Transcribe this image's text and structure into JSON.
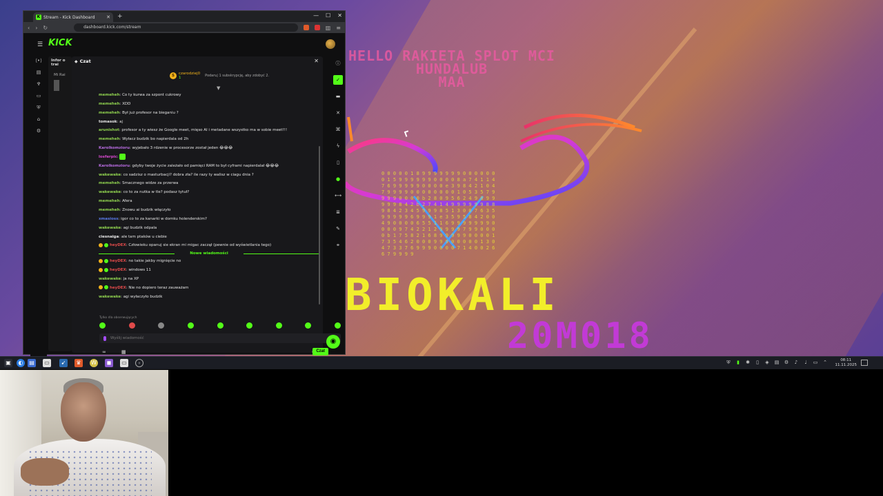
{
  "browser": {
    "tab_title": "Stream - Kick Dashboard",
    "url": "dashboard.kick.com/stream",
    "brand": "KICK",
    "accent": "#53fc18"
  },
  "info_panel": {
    "title": "Infor o trai",
    "meta": "Mi Rai"
  },
  "chat": {
    "title": "Czat",
    "subscriber": {
      "name": "czarodziej0",
      "count": "1",
      "message": "Podaruj 1 subskrypcję, aby zdobyć 2."
    },
    "messages": [
      {
        "user": "memeheh",
        "color": "#8fd14f",
        "text": "Co ty kurwa za szpont cukrowy"
      },
      {
        "user": "memeheh",
        "color": "#8fd14f",
        "text": "XDD"
      },
      {
        "user": "memeheh",
        "color": "#8fd14f",
        "text": "Był już profesor na bieganiu ?"
      },
      {
        "user": "tomasok",
        "color": "#e6e6e6",
        "text": "aj"
      },
      {
        "user": "arunishot",
        "color": "#8fd14f",
        "text": "profesor a ty wiesz że Google meet, mięso AI i metadane wszystko ma w sobie meet!!!"
      },
      {
        "user": "memeheh",
        "color": "#8fd14f",
        "text": "Wyłacz budzik bo napierdala od 2h"
      },
      {
        "user": "Karolkomzioru",
        "color": "#b86ce0",
        "text": "wyjebało 3 rdzenie w procesorze został jeden 😂😂😂"
      },
      {
        "user": "losferpic",
        "color": "#d94ad0",
        "text": ""
      },
      {
        "user": "Karolkomzioru",
        "color": "#b86ce0",
        "text": "gdyby twoje życie zależało od pamięci RAM to był cyframi napierdalał 😂😂😂"
      },
      {
        "user": "wakewake",
        "color": "#8fd14f",
        "text": "co sadzisz o masturbacji? dobra zła? ile razy ty walisz w ciagu dnia ?"
      },
      {
        "user": "memeheh",
        "color": "#8fd14f",
        "text": "Smacznego widze za przerwa"
      },
      {
        "user": "wakewake",
        "color": "#8fd14f",
        "text": "co to za nutka w tle? podasz tytuł?"
      },
      {
        "user": "memeheh",
        "color": "#8fd14f",
        "text": "Afera"
      },
      {
        "user": "memeheh",
        "color": "#8fd14f",
        "text": "Znowu ai budzik włączyło"
      },
      {
        "user": "xmasioss",
        "color": "#5a7be8",
        "text": "igor co to za kanarki w domku holenderskim?"
      },
      {
        "user": "wakewake",
        "color": "#8fd14f",
        "text": "agi budzik odpala"
      },
      {
        "user": "ciesnaiga",
        "color": "#e6e6e6",
        "text": "ale tam ptaków u ciebie"
      },
      {
        "user": "heyDEX",
        "color": "#e04a4a",
        "text": "Człowieku opanuj sie ekran mi migac zaczął (pewnie od wyświetlania tego)"
      }
    ],
    "new_messages_label": "Nowe wiadomości",
    "new_messages": [
      {
        "user": "heyDEX",
        "color": "#e04a4a",
        "text": "no takie jakby mignięcie no"
      },
      {
        "user": "heyDEX",
        "color": "#e04a4a",
        "text": "windows 11"
      },
      {
        "user": "wakewake",
        "color": "#8fd14f",
        "text": "ja na XP"
      },
      {
        "user": "heyDEX",
        "color": "#e04a4a",
        "text": "Nie no dopiero teraz zauważam"
      },
      {
        "user": "wakewake",
        "color": "#8fd14f",
        "text": "agi wyłaczyło budzik"
      }
    ],
    "followers_only": "Tylko dla obserwujących",
    "input_placeholder": "Wyślij wiadomość",
    "infinity": "∞",
    "send_label": "Czat"
  },
  "wallpaper": {
    "line1": "HELLO RAKIETA SPLOT MCI",
    "line2": "HUNDALUB",
    "line3": "MAA",
    "big1": "BIOKALI",
    "big2": "20M018",
    "digits": "0 0 0 0 0 1 8 9 9 9 9 9 9 9 0 0 0 0 0 0 0 1 5 9 9 9 9 9 9 0 0 0 0 8 a 7 4 1 1 4 7 6 9 9 9 9 9 0 0 0 0 e 3 9 8 4 2 1 0 4 7 9 9 9 9 0 0 0 0 0 0 0 0 1 0 5 3 5 7 9 9 9 9 0 0 0 0 b 2 8 0 9 5 6 2 4 9 8 9 9 9 9 9 8 4 2 b 2 7 4 1 4 9 9 9 9 9 9 8 8 9 8 4 2 3 4 5 9 9 9 8 5 1 3 0 0 7 6 3 5 9 9 9 9 9 6 9 9 9 1 e 3 5 9 5 8 4 2 0 0 4 9 0 0 0 0 6 5 5 1 1 6 9 9 9 9 9 9 9 0 0 0 0 9 7 4 2 2 1 2 9 9 9 9 7 9 9 0 0 0 0 b 1 7 5 8 2 1 6 8 9 9 9 9 9 0 0 0 0 1 7 3 5 4 6 2 0 0 0 9 9 9 0 0 0 0 0 1 3 0 4 7 3 3 7 6 9 9 9 0 0 0 0 7 1 4 0 0 2 6 6 7 9 9 9 9"
  },
  "taskbar": {
    "time": "08:11",
    "date": "11.11.2025"
  }
}
